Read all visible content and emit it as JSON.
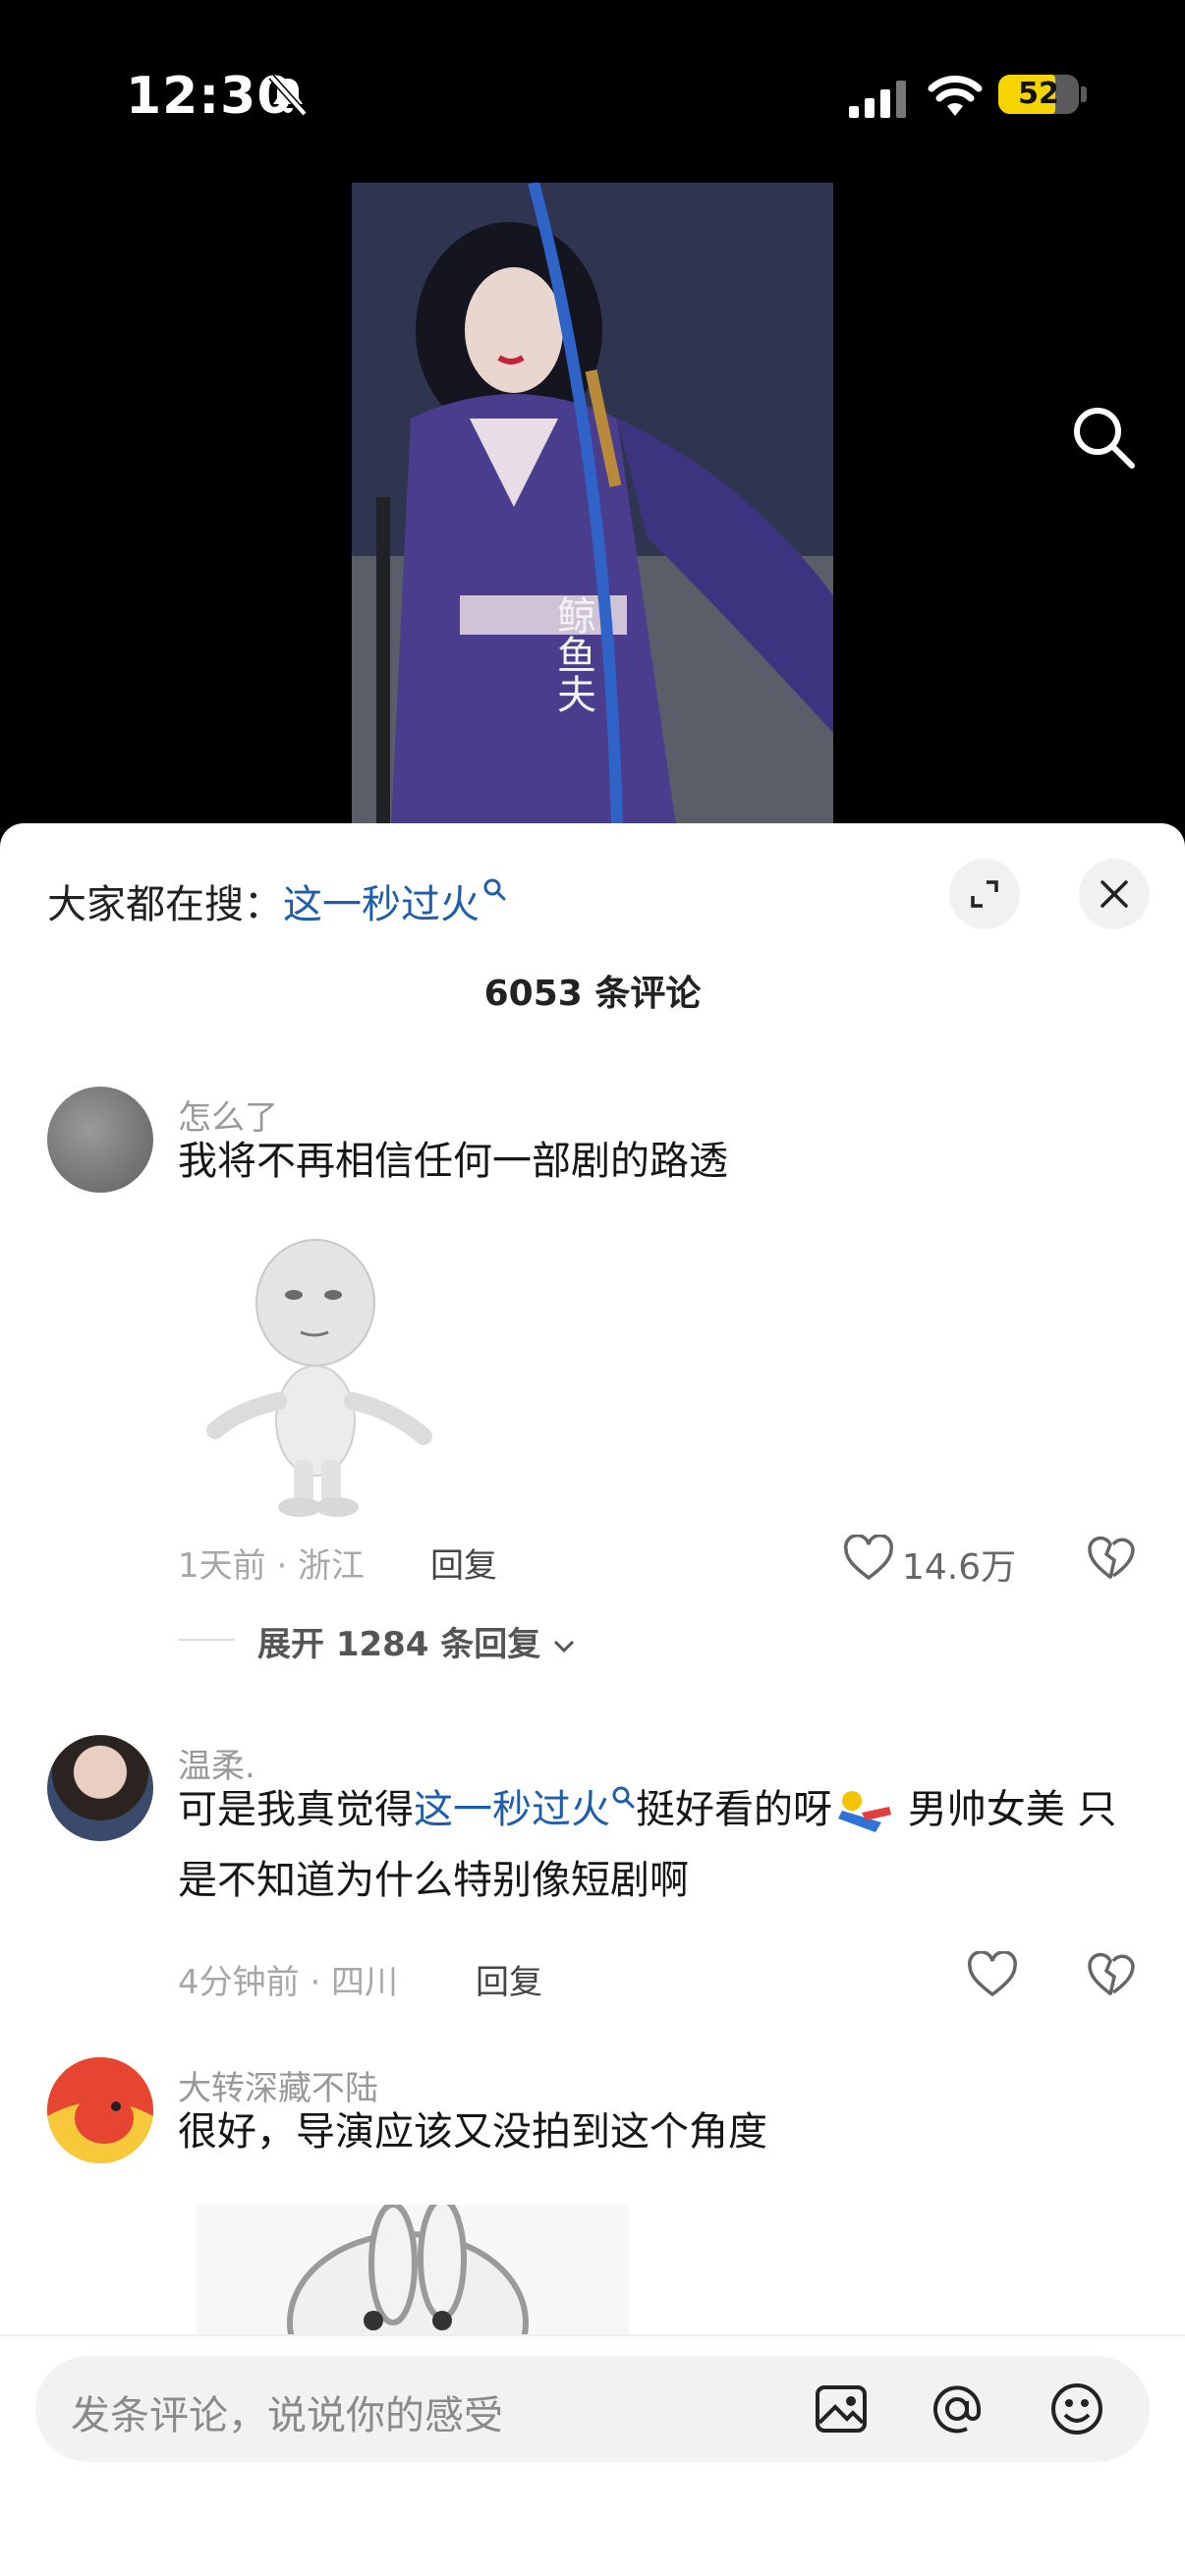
{
  "status_bar": {
    "time": "12:30",
    "battery_level": "52"
  },
  "header": {
    "hot_search_prefix": "大家都在搜：",
    "hot_search_term": "这一秒过火",
    "comment_count": "6053 条评论"
  },
  "video": {
    "overlay_caption": "鲸鱼夫"
  },
  "comments": [
    {
      "name": "怎么了",
      "text": "我将不再相信任何一部剧的路透",
      "meta": "1天前 · 浙江",
      "reply_label": "回复",
      "likes": "14.6万",
      "expand_label": "展开 1284 条回复"
    },
    {
      "name": "温柔.",
      "text_before": "可是我真觉得",
      "text_link": "这一秒过火",
      "text_after": "挺好看的呀",
      "text_after2": " 男帅女美 只是不知道为什么特别像短剧啊",
      "meta": "4分钟前 · 四川",
      "reply_label": "回复"
    },
    {
      "name": "大转深藏不陆",
      "text": "很好，导演应该又没拍到这个角度"
    }
  ],
  "input": {
    "placeholder": "发条评论，说说你的感受"
  },
  "colors": {
    "link": "#1f5fa8",
    "battery": "#f5d400",
    "sheet_bg": "#ffffff"
  }
}
